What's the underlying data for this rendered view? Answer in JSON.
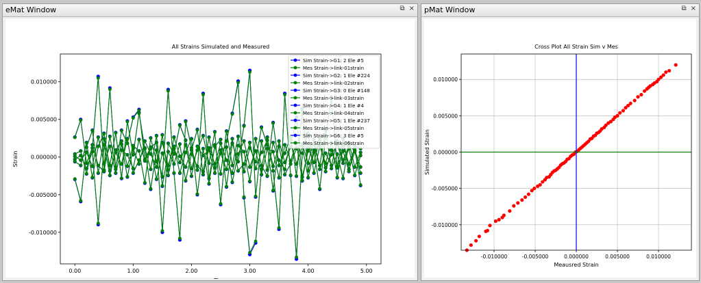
{
  "windows": {
    "emat_title": "eMat Window",
    "pmat_title": "pMat Window",
    "float_glyph": "⧉",
    "close_glyph": "×"
  },
  "chart_data": [
    {
      "type": "line",
      "title": "All Strains Simulated and Measured",
      "xlabel": "Time",
      "ylabel": "Strain",
      "xlim": [
        -0.25,
        5.25
      ],
      "ylim": [
        -0.0142,
        0.0137
      ],
      "x_ticks": [
        "0.00",
        "1.00",
        "2.00",
        "3.00",
        "4.00",
        "5.00"
      ],
      "y_ticks": [
        "-0.010000",
        "-0.005000",
        "0.000000",
        "0.005000",
        "0.010000"
      ],
      "legend_position": "top-right",
      "legend": [
        "Sim Strain->G1: 2 Ele #5",
        "Mes Strain->link-01strain",
        "Sim Strain->G2: 1 Ele #224",
        "Mes Strain->link-02strain",
        "Sim Strain->G3: 0 Ele #148",
        "Mes Strain->link-03strain",
        "Sim Strain->G4: 1 Ele #4",
        "Mes Strain->link-04strain",
        "Sim Strain->G5: 1 Ele #237",
        "Mes Strain->link-05strain",
        "Sim Strain->G6: 3 Ele #5",
        "Mes Strain->link-06strain"
      ],
      "sim_color": "#0000ff",
      "mes_color": "#008000",
      "x": [
        0.0,
        0.1,
        0.2,
        0.3,
        0.4,
        0.5,
        0.6,
        0.7,
        0.8,
        0.9,
        1.0,
        1.1,
        1.2,
        1.3,
        1.4,
        1.5,
        1.6,
        1.7,
        1.8,
        1.9,
        2.0,
        2.1,
        2.2,
        2.3,
        2.4,
        2.5,
        2.6,
        2.7,
        2.8,
        2.9,
        3.0,
        3.1,
        3.2,
        3.3,
        3.4,
        3.5,
        3.6,
        3.7,
        3.8,
        3.9,
        4.0,
        4.1,
        4.2,
        4.3,
        4.4,
        4.5,
        4.6,
        4.7,
        4.8,
        4.9
      ],
      "series": [
        {
          "values": [
            0.0026,
            0.0049,
            -0.0008,
            0.0012,
            0.0105,
            -0.0017,
            0.009,
            -0.0016,
            0.0035,
            0.0018,
            0.0052,
            0.0062,
            -0.0003,
            0.0013,
            0.0019,
            -0.0098,
            0.0018,
            0.0004,
            0.0042,
            0.0022,
            -0.0015,
            0.0009,
            0.0028,
            -0.0008,
            0.0033,
            -0.0062,
            0.0021,
            0.0057,
            0.0099,
            -0.0053,
            -0.0127,
            -0.0112,
            -0.0016,
            0.0026,
            -0.0018,
            -0.0094,
            0.0083,
            -0.0024,
            -0.0133,
            0.0005,
            0.0031,
            -0.0021,
            0.0014,
            -0.0008,
            0.0019,
            -0.0027,
            0.0016,
            -0.0009,
            0.0012,
            -0.0037
          ]
        },
        {
          "values": [
            -0.0029,
            -0.0058,
            0.0013,
            0.0035,
            -0.0021,
            0.0024,
            -0.0011,
            0.0032,
            -0.0028,
            0.0047,
            0.0003,
            0.0058,
            0.0011,
            -0.0042,
            0.0009,
            -0.0026,
            0.0088,
            -0.0021,
            -0.0108,
            0.0047,
            0.0012,
            -0.0017,
            0.0083,
            -0.0028,
            0.0014,
            0.0023,
            -0.0039,
            0.0018,
            -0.0006,
            0.0041,
            0.0113,
            -0.0052,
            0.0021,
            -0.0017,
            0.0045,
            -0.0011,
            0.0005,
            0.0027,
            -0.0025,
            0.0063,
            -0.0018,
            0.0009,
            -0.0042,
            0.0026,
            0.0078,
            -0.0014,
            0.0008,
            -0.0019,
            0.0015,
            0.0011
          ]
        },
        {
          "values": [
            -0.0003,
            0.0002,
            -0.0015,
            0.0007,
            -0.0088,
            0.0016,
            -0.0024,
            0.0009,
            0.0021,
            -0.0012,
            0.0015,
            0.0008,
            -0.0034,
            0.0025,
            -0.0006,
            0.0019,
            -0.0011,
            0.0014,
            -0.0021,
            0.0006,
            0.0024,
            -0.0049,
            0.0011,
            -0.0035,
            0.0016,
            -0.0022,
            0.0034,
            -0.0011,
            0.0027,
            -0.0019,
            0.0012,
            -0.0006,
            0.0039,
            0.0016,
            -0.0044,
            0.0021,
            -0.0007,
            0.0013,
            0.0052,
            -0.0026,
            0.0008,
            0.0017,
            -0.0011,
            0.0035,
            -0.0015,
            0.0004,
            -0.0028,
            0.0019,
            -0.0013,
            0.0006
          ]
        },
        {
          "values": [
            0.0001,
            -0.0004,
            0.0006,
            -0.0012,
            0.0026,
            -0.0008,
            0.0014,
            -0.0021,
            0.0009,
            0.0003,
            -0.0015,
            0.0023,
            -0.0005,
            0.0011,
            -0.0029,
            0.0005,
            -0.0017,
            0.0026,
            0.0001,
            -0.0013,
            0.0009,
            0.0036,
            -0.0023,
            0.0012,
            -0.0009,
            0.0018,
            -0.0004,
            -0.0021,
            0.0015,
            0.0007,
            -0.0032,
            0.0024,
            -0.0011,
            -0.0025,
            0.0019,
            -0.0004,
            -0.0016,
            0.0022,
            -0.0009,
            0.0014,
            -0.0027,
            0.0006,
            0.0021,
            -0.0014,
            0.0003,
            0.0017,
            -0.0008,
            0.0011,
            -0.0024,
            0.0002
          ]
        },
        {
          "values": [
            -0.0006,
            -0.0011,
            0.0019,
            -0.0027,
            0.0014,
            0.0031,
            -0.0018,
            0.0006,
            -0.0009,
            0.0024,
            -0.0021,
            -0.0004,
            0.0012,
            -0.0016,
            0.0028,
            -0.0038,
            0.0007,
            -0.0009,
            0.0017,
            -0.0031,
            0.0004,
            -0.0012,
            -0.0019,
            0.0026,
            -0.0014,
            0.0009,
            0.0013,
            -0.0033,
            0.0004,
            0.0021,
            -0.0013,
            0.0008,
            -0.0023,
            0.0011,
            0.0007,
            -0.0027,
            0.0016,
            -0.0005,
            0.0018,
            -0.0031,
            0.0012,
            -0.0007,
            0.0025,
            -0.0019,
            0.0009,
            -0.0012,
            0.0024,
            -0.0016,
            0.0007,
            -0.0021
          ]
        },
        {
          "values": [
            0.0004,
            0.0008,
            -0.0022,
            0.0016,
            -0.0011,
            -0.0019,
            0.0027,
            -0.0013,
            0.0017,
            -0.0026,
            0.0011,
            -0.0009,
            0.0021,
            0.0004,
            -0.0013,
            0.0029,
            -0.0024,
            0.0011,
            -0.0007,
            0.0016,
            -0.0025,
            0.0014,
            0.0002,
            0.0009,
            -0.0021,
            0.0005,
            -0.0016,
            0.0024,
            -0.0018,
            -0.0009,
            0.0019,
            -0.0015,
            0.0006,
            0.0022,
            -0.0012,
            0.0014,
            -0.0023,
            -0.0009,
            0.0011,
            0.0017,
            -0.0008,
            0.0023,
            -0.0016,
            0.0005,
            -0.0011,
            0.0021,
            -0.0004,
            0.0014,
            0.0009,
            -0.0013
          ]
        }
      ]
    },
    {
      "type": "scatter",
      "title": "Cross Plot All Strain Sim v Mes",
      "xlabel": "Meausred Strain",
      "ylabel": "Simulated Strain",
      "xlim": [
        -0.014,
        0.014
      ],
      "ylim": [
        -0.0135,
        0.0135
      ],
      "x_ticks": [
        "-0.010000",
        "-0.005000",
        "0.000000",
        "0.005000",
        "0.010000"
      ],
      "y_ticks": [
        "-0.010000",
        "-0.005000",
        "0.000000",
        "0.005000",
        "0.010000"
      ],
      "grid": true,
      "point_color": "#ff0000",
      "vline_color": "#0000ff",
      "hline_color": "#008000",
      "x": [
        -0.0133,
        -0.0128,
        -0.0122,
        -0.0118,
        -0.011,
        -0.0108,
        -0.0105,
        -0.0098,
        -0.0094,
        -0.009,
        -0.0088,
        -0.0081,
        -0.0076,
        -0.0071,
        -0.0066,
        -0.0062,
        -0.0058,
        -0.0054,
        -0.0051,
        -0.0047,
        -0.0044,
        -0.0041,
        -0.0038,
        -0.0036,
        -0.0033,
        -0.0031,
        -0.0029,
        -0.0027,
        -0.0025,
        -0.0023,
        -0.0021,
        -0.0019,
        -0.0017,
        -0.0015,
        -0.0013,
        -0.0011,
        -0.0009,
        -0.0007,
        -0.0005,
        -0.0003,
        -0.0001,
        0.0001,
        0.0003,
        0.0005,
        0.0007,
        0.0009,
        0.0011,
        0.0013,
        0.0015,
        0.0017,
        0.0019,
        0.0021,
        0.0023,
        0.0025,
        0.0027,
        0.0029,
        0.0031,
        0.0034,
        0.0036,
        0.0039,
        0.0042,
        0.0045,
        0.0047,
        0.005,
        0.0053,
        0.0057,
        0.006,
        0.0063,
        0.0066,
        0.0071,
        0.0075,
        0.0079,
        0.0083,
        0.0086,
        0.0088,
        0.009,
        0.0093,
        0.0095,
        0.0098,
        0.01,
        0.0103,
        0.0106,
        0.0109,
        0.0113,
        0.0121
      ],
      "y": [
        -0.0135,
        -0.0128,
        -0.0122,
        -0.0116,
        -0.0109,
        -0.0108,
        -0.0101,
        -0.0095,
        -0.0093,
        -0.009,
        -0.0087,
        -0.0081,
        -0.0074,
        -0.007,
        -0.0066,
        -0.0062,
        -0.0058,
        -0.0053,
        -0.005,
        -0.0047,
        -0.0045,
        -0.0041,
        -0.0038,
        -0.0035,
        -0.0034,
        -0.0031,
        -0.0028,
        -0.0026,
        -0.0025,
        -0.0023,
        -0.0021,
        -0.0018,
        -0.0016,
        -0.0015,
        -0.0013,
        -0.001,
        -0.0009,
        -0.0006,
        -0.0004,
        -0.0003,
        0.0,
        0.0001,
        0.0003,
        0.0005,
        0.0007,
        0.0009,
        0.0011,
        0.0013,
        0.0015,
        0.0018,
        0.0019,
        0.0022,
        0.0023,
        0.0026,
        0.0027,
        0.0029,
        0.0032,
        0.0034,
        0.0037,
        0.004,
        0.0042,
        0.0045,
        0.0048,
        0.005,
        0.0054,
        0.0057,
        0.0061,
        0.0064,
        0.0067,
        0.0071,
        0.0076,
        0.0079,
        0.0084,
        0.0087,
        0.0089,
        0.0091,
        0.0093,
        0.0095,
        0.0097,
        0.01,
        0.0103,
        0.0106,
        0.011,
        0.0112,
        0.012
      ]
    }
  ]
}
